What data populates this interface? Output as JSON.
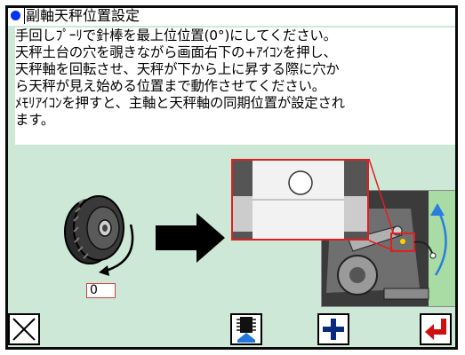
{
  "window": {
    "title": "副軸天秤位置設定"
  },
  "instructions": {
    "lines": [
      "手回しﾌﾟｰﾘで針棒を最上位位置(0°)にしてください。",
      "天秤土台の穴を覗きながら画面右下の+ｱｲｺﾝを押し、",
      "天秤軸を回転させ、天秤が下から上に昇する際に穴か",
      "ら天秤が見え始める位置まで動作させてください。",
      "ﾒﾓﾘｱｲｺﾝを押すと、主軸と天秤軸の同期位置が設定され",
      "ます。"
    ]
  },
  "angle_input": {
    "value": "0"
  },
  "toolbar": {
    "cancel_icon": "close-x-icon",
    "memory_icon": "memory-chip-icon",
    "plus_icon": "plus-icon",
    "enter_icon": "enter-return-icon"
  },
  "colors": {
    "background": "#cde8d6",
    "accent_blue": "#0033cc",
    "enter_red": "#d01010",
    "highlight_red": "#e02020",
    "machine_green": "#a8dca4"
  }
}
